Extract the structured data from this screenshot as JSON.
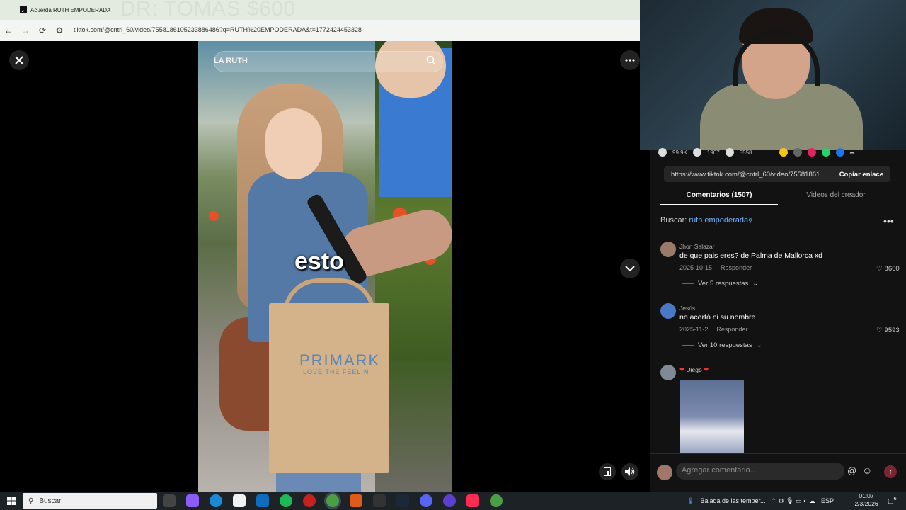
{
  "browser": {
    "tab_title": "Acuerda RUTH EMPODERADA",
    "banner_text": "DR: TOMAS $600",
    "url": "tiktok.com/@cntrl_60/video/7558186105233886486?q=RUTH%20EMPODERADA&t=1772424453328"
  },
  "video": {
    "search_query": "LA RUTH",
    "caption": "esto",
    "bag_brand": "PRIMARK",
    "bag_tagline": "LOVE THE FEELIN"
  },
  "panel": {
    "stats": [
      "99.9K",
      "1907",
      "5558"
    ],
    "link": "https://www.tiktok.com/@cntrl_60/video/75581861...",
    "copy_link": "Copiar enlace",
    "tabs": {
      "comments": "Comentarios (1507)",
      "creator": "Videos del creador"
    },
    "search_label": "Buscar:",
    "search_query": "ruth empoderada",
    "comments": [
      {
        "name": "Jhon Salazar",
        "text": "de que pais eres? de Palma de Mallorca xd",
        "date": "2025-10-15",
        "reply": "Responder",
        "likes": "8660",
        "replies": "Ver 5 respuestas"
      },
      {
        "name": "Jesús",
        "text": "no acertó ni su nombre",
        "date": "2025-11-2",
        "reply": "Responder",
        "likes": "9593",
        "replies": "Ver 10 respuestas"
      },
      {
        "name": "Diego"
      }
    ],
    "composer_placeholder": "Agregar comentario..."
  },
  "taskbar": {
    "search": "Buscar",
    "weather": "Bajada de las temper...",
    "lang": "ESP",
    "time": "01:07",
    "date": "2/3/2026",
    "notifications": "6"
  },
  "colors": {
    "accent_link": "#6fb3ff",
    "panel_bg": "#121212",
    "send": "#7a2630"
  }
}
